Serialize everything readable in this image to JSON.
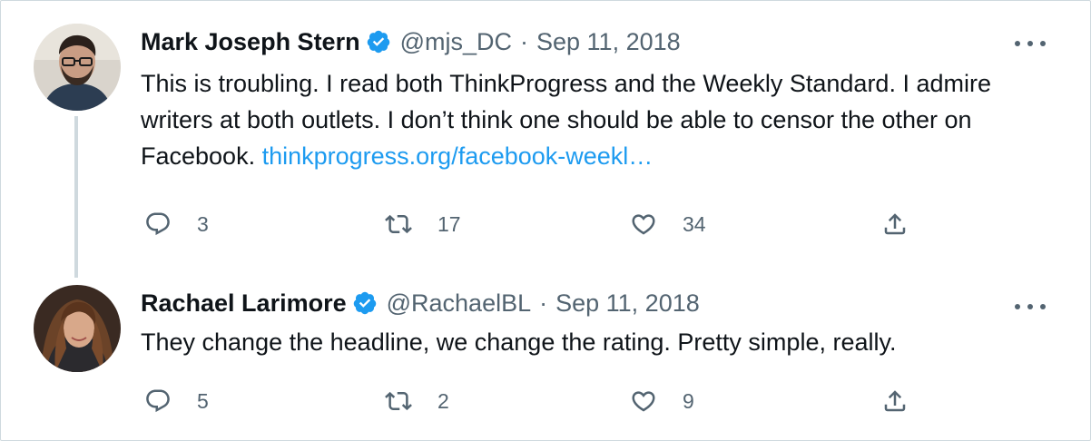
{
  "colors": {
    "text": "#0f1419",
    "muted": "#536471",
    "link": "#1d9bf0",
    "verified": "#1d9bf0",
    "border": "#cfd9de"
  },
  "tweets": [
    {
      "name": "Mark Joseph Stern",
      "handle": "@mjs_DC",
      "separator": "·",
      "date": "Sep 11, 2018",
      "text": "This is troubling. I read both ThinkProgress and the Weekly Standard. I admire writers at both outlets. I don’t think one should be able to censor the other on Facebook.",
      "link": "thinkprogress.org/facebook-weekl…",
      "replies": "3",
      "retweets": "17",
      "likes": "34"
    },
    {
      "name": "Rachael Larimore",
      "handle": "@RachaelBL",
      "separator": "·",
      "date": "Sep 11, 2018",
      "text": "They change the headline, we change the rating. Pretty simple, really.",
      "replies": "5",
      "retweets": "2",
      "likes": "9"
    }
  ]
}
